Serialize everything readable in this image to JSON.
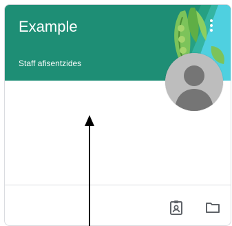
{
  "card": {
    "title": "Example",
    "subtitle": "Staff afisentzides"
  },
  "icons": {
    "more": "more-vert-icon",
    "assignments": "assignment-ind-icon",
    "folder": "folder-icon",
    "avatar": "person-avatar"
  },
  "colors": {
    "header": "#1e8e75",
    "accent_cyan": "#4fd0e0",
    "avatar_bg": "#bdbdbd",
    "avatar_fg": "#757575",
    "border": "#dadce0",
    "icon": "#5f6368"
  }
}
